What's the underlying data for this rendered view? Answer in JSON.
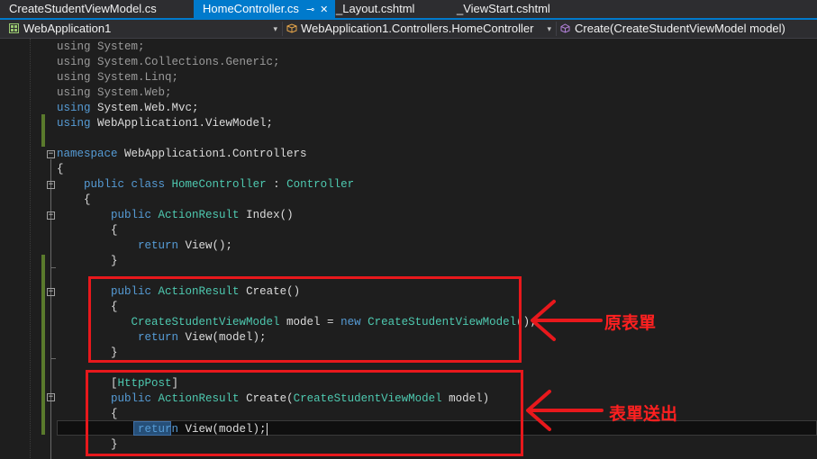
{
  "tabs": [
    {
      "label": "CreateStudentViewModel.cs",
      "active": false
    },
    {
      "label": "HomeController.cs",
      "active": true,
      "pin": "⊸",
      "close": "✕"
    },
    {
      "label": "_Layout.cshtml",
      "active": false
    },
    {
      "label": "_ViewStart.cshtml",
      "active": false
    }
  ],
  "nav": {
    "project": "WebApplication1",
    "class": "WebApplication1.Controllers.HomeController",
    "member": "Create(CreateStudentViewModel model)",
    "dropdown_glyph": "▾"
  },
  "code": {
    "l0": {
      "kw": "using",
      "rest": " System;"
    },
    "l1": {
      "kw": "using",
      "rest": " System.Collections.Generic;"
    },
    "l2": {
      "kw": "using",
      "rest": " System.Linq;"
    },
    "l3": {
      "kw": "using",
      "rest": " System.Web;"
    },
    "l4": {
      "kw": "using",
      "rest": " System.Web.Mvc;"
    },
    "l5": {
      "kw": "using",
      "rest": " WebApplication1.ViewModel;"
    },
    "l7": {
      "kw": "namespace",
      "rest": " WebApplication1.Controllers"
    },
    "l8": {
      "text": "{"
    },
    "l9": {
      "indent": "    ",
      "kw1": "public",
      "kw2": " class",
      "name": " HomeController",
      "colon": " : ",
      "base": "Controller"
    },
    "l10": {
      "text": "    {"
    },
    "l11": {
      "indent": "        ",
      "kw": "public",
      "type": " ActionResult",
      "rest": " Index()"
    },
    "l12": {
      "text": "        {"
    },
    "l13": {
      "indent": "            ",
      "kw": "return",
      "rest": " View();"
    },
    "l14": {
      "text": "        }"
    },
    "l16": {
      "indent": "        ",
      "kw": "public",
      "type": " ActionResult",
      "rest": " Create()"
    },
    "l17": {
      "text": "        {"
    },
    "l18": {
      "indent": "           ",
      "type1": "CreateStudentViewModel",
      "mid": " model = ",
      "kw": "new",
      "type2": " CreateStudentViewModel",
      "rest": "();"
    },
    "l19": {
      "indent": "            ",
      "kw": "return",
      "rest": " View(model);"
    },
    "l20": {
      "text": "        }"
    },
    "l22": {
      "indent": "        ",
      "open": "[",
      "attr": "HttpPost",
      "close": "]"
    },
    "l23": {
      "indent": "        ",
      "kw": "public",
      "type": " ActionResult",
      "rest1": " Create(",
      "ptype": "CreateStudentViewModel",
      "rest2": " model)"
    },
    "l24": {
      "text": "        {"
    },
    "l25": {
      "indent": "            ",
      "kw": "return",
      "rest": " View(model);"
    },
    "l26": {
      "text": "        }"
    }
  },
  "annotations": {
    "original_form": "原表單",
    "form_submit": "表單送出"
  },
  "colors": {
    "keyword": "#569cd6",
    "type": "#4ec9b0",
    "text": "#dcdcdc",
    "highlight_box": "#e8181c",
    "active_tab": "#007acc"
  }
}
